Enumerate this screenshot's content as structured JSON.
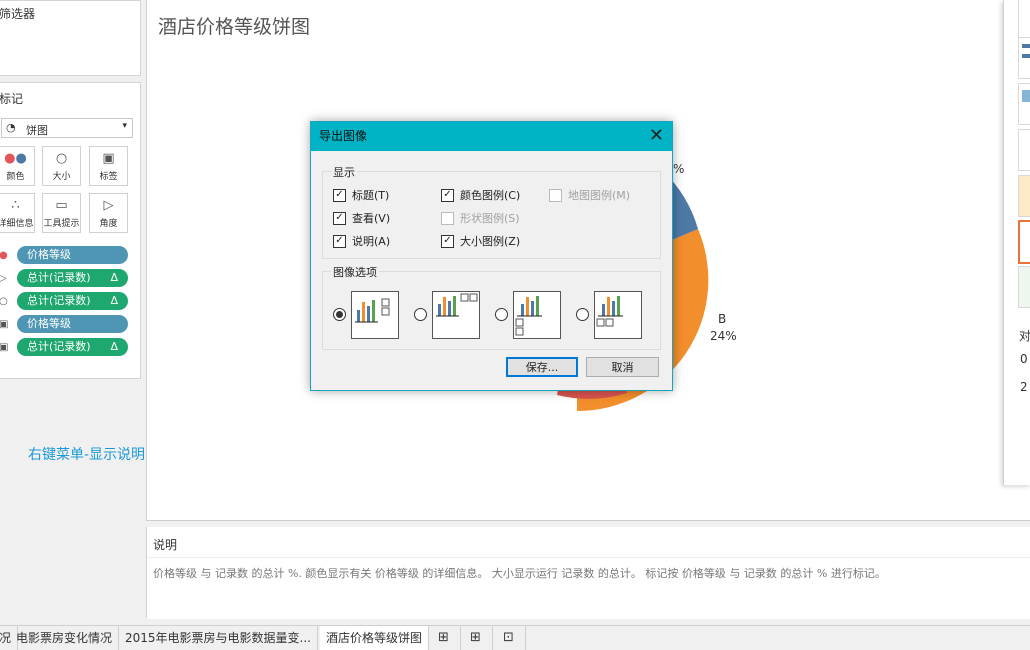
{
  "filters_card": {
    "title": "筛选器"
  },
  "marks_card": {
    "title": "标记",
    "mark_type": "饼图",
    "buttons": [
      "颜色",
      "大小",
      "标签",
      "详细信息",
      "工具提示",
      "角度"
    ],
    "pills": [
      {
        "label": "价格等级",
        "delta": ""
      },
      {
        "label": "总计(记录数)",
        "delta": "Δ"
      },
      {
        "label": "总计(记录数)",
        "delta": "Δ"
      },
      {
        "label": "价格等级",
        "delta": ""
      },
      {
        "label": "总计(记录数)",
        "delta": "Δ"
      }
    ]
  },
  "annotation": "右键菜单-显示说明",
  "sheet": {
    "title": "酒店价格等级饼图",
    "pie_label_b": "B",
    "pie_pct_b": "24%",
    "pie_pct_partial": "%"
  },
  "dialog": {
    "title": "导出图像",
    "show_group": "显示",
    "checkboxes": [
      {
        "label": "标题(T)",
        "checked": true,
        "disabled": false
      },
      {
        "label": "颜色图例(C)",
        "checked": true,
        "disabled": false
      },
      {
        "label": "地图图例(M)",
        "checked": false,
        "disabled": true
      },
      {
        "label": "查看(V)",
        "checked": true,
        "disabled": false
      },
      {
        "label": "形状图例(S)",
        "checked": false,
        "disabled": true
      },
      {
        "label": "说明(A)",
        "checked": true,
        "disabled": false
      },
      {
        "label": "大小图例(Z)",
        "checked": true,
        "disabled": false
      }
    ],
    "image_options_group": "图像选项",
    "save_button": "保存...",
    "cancel_button": "取消"
  },
  "caption": {
    "title": "说明",
    "text": "价格等级 与 记录数 的总计 %. 颜色显示有关 价格等级 的详细信息。 大小显示运行 记录数 的总计。 标记按 价格等级 与 记录数 的总计 % 进行标记。"
  },
  "right_panel": {
    "label": "对",
    "value1": "0",
    "value2": "2"
  },
  "tabs": [
    "况",
    "电影票房变化情况",
    "2015年电影票房与电影数据量变...",
    "酒店价格等级饼图"
  ],
  "colors": {
    "accent": "#00b3c5",
    "pie_orange": "#f28e2b",
    "pie_blue": "#4e79a7",
    "pie_red": "#e15759",
    "pill_blue": "#4e96b3",
    "pill_green": "#1ea76e"
  }
}
